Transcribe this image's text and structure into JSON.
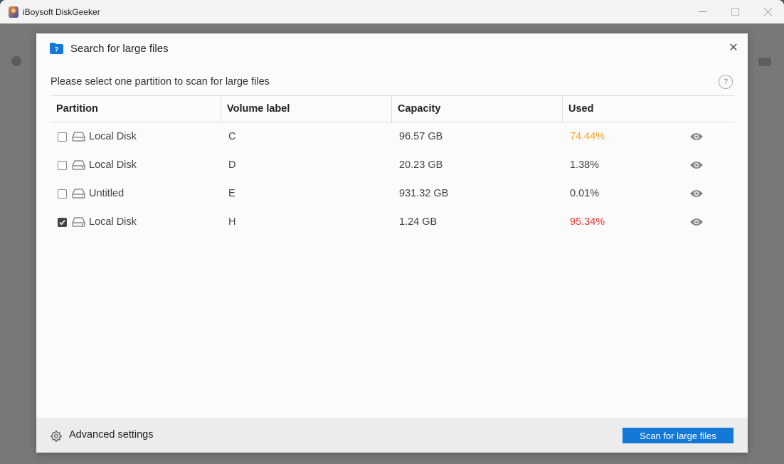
{
  "window": {
    "title": "iBoysoft DiskGeeker",
    "controls": [
      "minimize",
      "maximize",
      "close"
    ]
  },
  "dialog": {
    "title": "Search for large files",
    "instruction": "Please select one partition to scan for large files",
    "help_symbol": "?",
    "close_symbol": "✕",
    "table": {
      "headers": [
        "Partition",
        "Volume label",
        "Capacity",
        "Used"
      ],
      "rows": [
        {
          "checked": false,
          "name": "Local Disk",
          "volume": "C",
          "capacity": "96.57 GB",
          "used": "74.44%",
          "used_color": "#f5a623"
        },
        {
          "checked": false,
          "name": "Local Disk",
          "volume": "D",
          "capacity": "20.23 GB",
          "used": "1.38%",
          "used_color": "#444444"
        },
        {
          "checked": false,
          "name": "Untitled",
          "volume": "E",
          "capacity": "931.32 GB",
          "used": "0.01%",
          "used_color": "#444444"
        },
        {
          "checked": true,
          "name": "Local Disk",
          "volume": "H",
          "capacity": "1.24 GB",
          "used": "95.34%",
          "used_color": "#e53935"
        }
      ]
    },
    "footer": {
      "advanced_settings": "Advanced settings",
      "scan_button": "Scan for large files"
    }
  },
  "colors": {
    "accent": "#1478d6",
    "warning": "#f5a623",
    "danger": "#e53935"
  }
}
